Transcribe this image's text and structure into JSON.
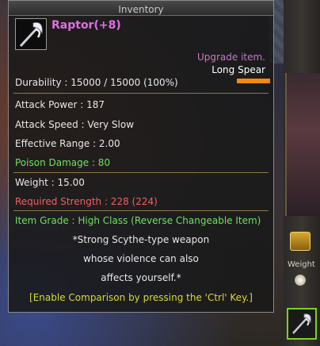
{
  "window": {
    "title": "Inventory"
  },
  "item": {
    "name": "Raptor(+8)",
    "upgrade_note": "Upgrade item.",
    "weapon_type": "Long Spear",
    "durability": "Durability : 15000 / 15000 (100%)",
    "attack_power": "Attack Power : 187",
    "attack_speed": "Attack Speed : Very Slow",
    "effective_range": "Effective Range : 2.00",
    "poison_damage": "Poison Damage : 80",
    "weight": "Weight : 15.00",
    "required_strength": "Required Strength : 228 (224)",
    "item_grade": "Item Grade : High Class (Reverse Changeable Item)",
    "description": [
      "*Strong Scythe-type weapon",
      "whose violence can also",
      "affects yourself.*"
    ],
    "comparison_hint": "[Enable Comparison by pressing the 'Ctrl' Key.]"
  },
  "side_panel": {
    "weight_label": "Weight"
  },
  "colors": {
    "item_name": "#e070e0",
    "upgrade_note": "#c878c8",
    "green_stat": "#6ee060",
    "red_stat": "#f06060",
    "hint_yellow": "#d8d838",
    "type_bar": "#f08a10"
  },
  "icons": {
    "item_icon": "scythe-spear-icon",
    "chest_icon": "treasure-chest-icon",
    "orb_icon": "orb-icon",
    "slot_icon": "scythe-spear-icon"
  }
}
